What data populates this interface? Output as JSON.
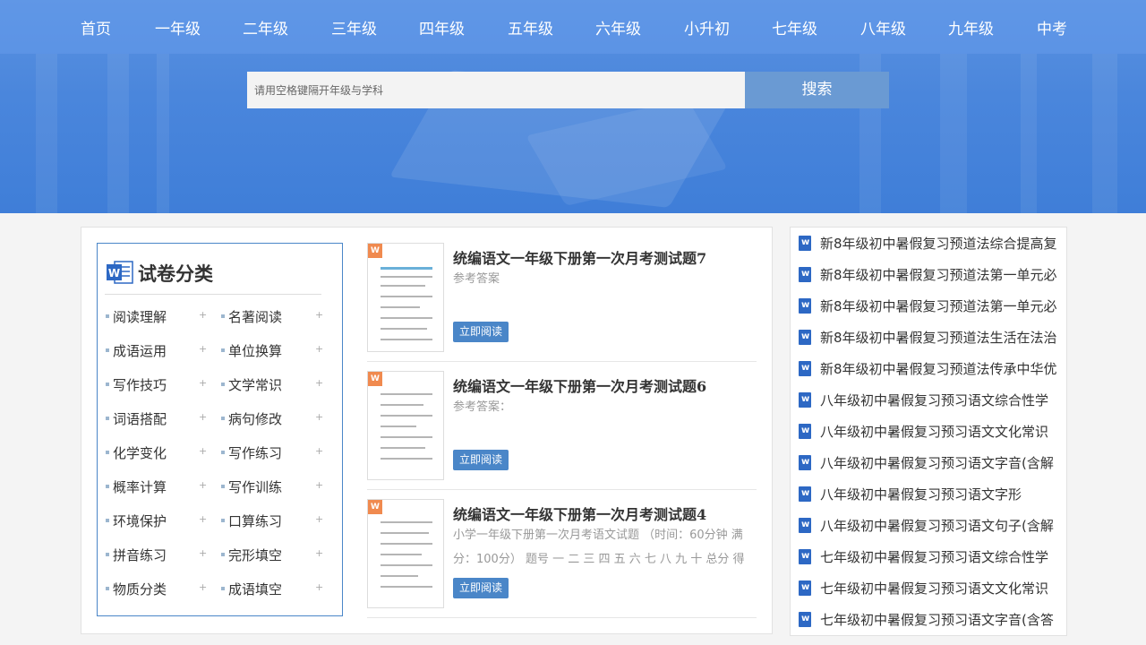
{
  "nav": [
    "首页",
    "一年级",
    "二年级",
    "三年级",
    "四年级",
    "五年级",
    "六年级",
    "小升初",
    "七年级",
    "八年级",
    "九年级",
    "中考"
  ],
  "search": {
    "placeholder": "请用空格键隔开年级与学科",
    "button": "搜索"
  },
  "category": {
    "title": "试卷分类",
    "items": [
      "阅读理解",
      "名著阅读",
      "成语运用",
      "单位换算",
      "写作技巧",
      "文学常识",
      "词语搭配",
      "病句修改",
      "化学变化",
      "写作练习",
      "概率计算",
      "写作训练",
      "环境保护",
      "口算练习",
      "拼音练习",
      "完形填空",
      "物质分类",
      "成语填空"
    ]
  },
  "docs": [
    {
      "badge": "W",
      "title": "统编语文一年级下册第一次月考测试题7",
      "desc": "参考答案",
      "button": "立即阅读"
    },
    {
      "badge": "W",
      "title": "统编语文一年级下册第一次月考测试题6",
      "desc": "参考答案：",
      "button": "立即阅读"
    },
    {
      "badge": "W",
      "title": "统编语文一年级下册第一次月考测试题4",
      "desc": "小学一年级下册第一次月考语文试题 （时间：60分钟 满分：100分） 题号 一 二 三 四 五 六 七 八 九 十 总分 得分",
      "button": "立即阅读"
    }
  ],
  "sidebar": [
    "新8年级初中暑假复习预道法综合提高复",
    "新8年级初中暑假复习预道法第一单元必",
    "新8年级初中暑假复习预道法第一单元必",
    "新8年级初中暑假复习预道法生活在法治",
    "新8年级初中暑假复习预道法传承中华优",
    "八年级初中暑假复习预习语文综合性学",
    "八年级初中暑假复习预习语文文化常识",
    "八年级初中暑假复习预习语文字音(含解",
    "八年级初中暑假复习预习语文字形",
    "八年级初中暑假复习预习语文句子(含解",
    "七年级初中暑假复习预习语文综合性学",
    "七年级初中暑假复习预习语文文化常识",
    "七年级初中暑假复习预习语文字音(含答"
  ],
  "colors": {
    "accent": "#4a86c8",
    "hero": "#4a86dc",
    "badge": "#f08a4f"
  }
}
